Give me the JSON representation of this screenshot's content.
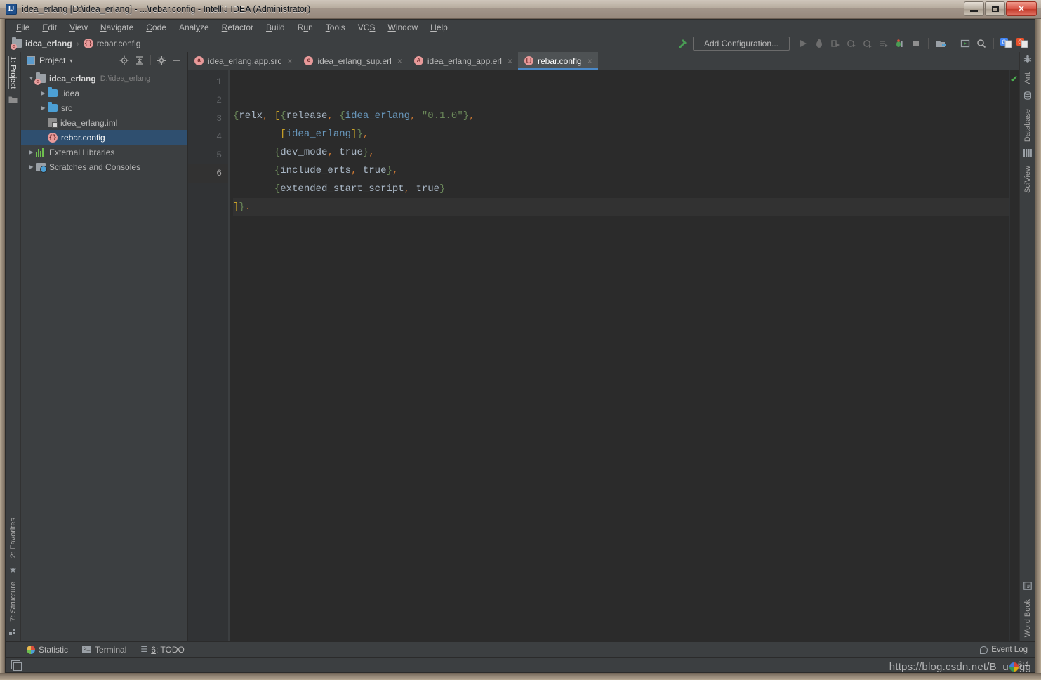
{
  "window": {
    "title": "idea_erlang [D:\\idea_erlang] - ...\\rebar.config - IntelliJ IDEA (Administrator)",
    "app_icon": "IJ",
    "buttons": {
      "minimize": "minimize-icon",
      "maximize": "maximize-icon",
      "close": "✕"
    }
  },
  "menu": [
    {
      "pre": "",
      "u": "F",
      "post": "ile"
    },
    {
      "pre": "",
      "u": "E",
      "post": "dit"
    },
    {
      "pre": "",
      "u": "V",
      "post": "iew"
    },
    {
      "pre": "",
      "u": "N",
      "post": "avigate"
    },
    {
      "pre": "",
      "u": "C",
      "post": "ode"
    },
    {
      "pre": "Anal",
      "u": "y",
      "post": "ze"
    },
    {
      "pre": "",
      "u": "R",
      "post": "efactor"
    },
    {
      "pre": "",
      "u": "B",
      "post": "uild"
    },
    {
      "pre": "R",
      "u": "u",
      "post": "n"
    },
    {
      "pre": "",
      "u": "T",
      "post": "ools"
    },
    {
      "pre": "VC",
      "u": "S",
      "post": ""
    },
    {
      "pre": "",
      "u": "W",
      "post": "indow"
    },
    {
      "pre": "",
      "u": "H",
      "post": "elp"
    }
  ],
  "breadcrumb": {
    "project": "idea_erlang",
    "separator": "›",
    "file": "rebar.config"
  },
  "toolbar": {
    "build_icon": "hammer-icon",
    "add_configuration_label": "Add Configuration...",
    "run_icon": "run-icon",
    "debug_icon": "debug-icon",
    "run_coverage_icon": "run-with-coverage-icon",
    "profile_icon": "profile-icon",
    "attach_icon": "attach-profiler-icon",
    "run_tests_icon": "run-tests-icon",
    "stop_icon": "stop-icon",
    "project_structure_icon": "project-structure-icon",
    "run_anything_icon": "run-anything-icon",
    "search_icon": "search-everywhere-icon",
    "translate_icon": "translate-icon",
    "translate_alt_icon": "translate-alt-icon"
  },
  "left_strip": {
    "top": [
      {
        "label": "1: Project",
        "underline": "1",
        "icon": "project-icon",
        "active": true
      }
    ],
    "bottom": [
      {
        "label": "2: Favorites",
        "underline": "2",
        "icon": "star-icon"
      },
      {
        "label": "7: Structure",
        "underline": "7",
        "icon": "structure-icon"
      }
    ]
  },
  "right_strip": {
    "top": [
      {
        "label": "Ant",
        "icon": "ant-icon"
      },
      {
        "label": "Database",
        "icon": "database-icon"
      },
      {
        "label": "SciView",
        "icon": "sciview-icon"
      }
    ],
    "bottom": [
      {
        "label": "Word Book",
        "icon": "word-book-icon"
      }
    ]
  },
  "project_panel": {
    "title": "Project",
    "caret": "▾",
    "tools": {
      "locate_icon": "locate-icon",
      "collapse_all_icon": "collapse-all-icon",
      "settings_icon": "gear-icon",
      "hide_icon": "hide-icon"
    },
    "tree": [
      {
        "indent": 0,
        "twisty": "▼",
        "icon": "module-icon",
        "label": "idea_erlang",
        "bold": true,
        "path": "D:\\idea_erlang",
        "selected": false
      },
      {
        "indent": 1,
        "twisty": "▶",
        "icon": "folder-icon",
        "label": ".idea",
        "bold": false,
        "path": "",
        "selected": false
      },
      {
        "indent": 1,
        "twisty": "▶",
        "icon": "folder-icon",
        "label": "src",
        "bold": false,
        "path": "",
        "selected": false
      },
      {
        "indent": 1,
        "twisty": "",
        "icon": "iml-icon",
        "label": "idea_erlang.iml",
        "bold": false,
        "path": "",
        "selected": false
      },
      {
        "indent": 1,
        "twisty": "",
        "icon": "erlang-icon",
        "label": "rebar.config",
        "bold": false,
        "path": "",
        "selected": true
      },
      {
        "indent": 0,
        "twisty": "▶",
        "icon": "library-icon",
        "label": "External Libraries",
        "bold": false,
        "path": "",
        "selected": false
      },
      {
        "indent": 0,
        "twisty": "▶",
        "icon": "scratch-icon",
        "label": "Scratches and Consoles",
        "bold": false,
        "path": "",
        "selected": false
      }
    ]
  },
  "editor": {
    "tabs": [
      {
        "label": "idea_erlang.app.src",
        "badge": "a",
        "active": false,
        "close": "×"
      },
      {
        "label": "idea_erlang_sup.erl",
        "badge": "e",
        "active": false,
        "close": "×"
      },
      {
        "label": "idea_erlang_app.erl",
        "badge": "A",
        "active": false,
        "close": "×"
      },
      {
        "label": "rebar.config",
        "badge": "{}",
        "active": true,
        "close": "×"
      }
    ],
    "line_numbers": [
      "1",
      "2",
      "3",
      "4",
      "5",
      "6"
    ],
    "current_line": 6,
    "inspection_status": "✔",
    "lines": [
      {
        "n": 1,
        "text": "{relx, [{release, {idea_erlang, \"0.1.0\"},"
      },
      {
        "n": 2,
        "text": "        [idea_erlang]},"
      },
      {
        "n": 3,
        "text": "       {dev_mode, true},"
      },
      {
        "n": 4,
        "text": "       {include_erts, true},"
      },
      {
        "n": 5,
        "text": "       {extended_start_script, true}"
      },
      {
        "n": 6,
        "text": "]}."
      }
    ]
  },
  "bottom_tabs": [
    {
      "label": "Statistic",
      "underline": "",
      "icon": "statistic-icon"
    },
    {
      "label": "Terminal",
      "underline": "",
      "icon": "terminal-icon"
    },
    {
      "label": "6: TODO",
      "underline": "6",
      "icon": "todo-icon"
    }
  ],
  "status_bar": {
    "caret_position": "6:4",
    "event_log": "Event Log",
    "event_log_icon": "event-log-icon",
    "toggle_icon": "toggle-toolwindows-icon"
  },
  "watermark": {
    "prefix": "https://blog.csdn.net/B_u",
    "suffix": "gg"
  },
  "colors": {
    "accent": "#4a88c7",
    "selection": "#2f4f6f",
    "editor_bg": "#2b2b2b",
    "panel_bg": "#3c3f41",
    "string": "#6a8759",
    "variable": "#6897bb",
    "ok": "#4caf50"
  }
}
